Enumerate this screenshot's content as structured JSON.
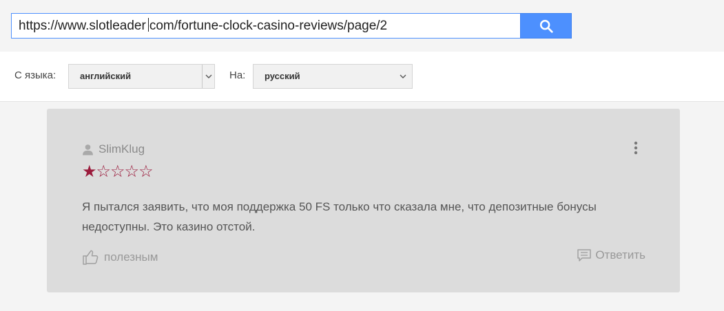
{
  "url_bar": {
    "url_part1": "https://www.slotleader",
    "url_part2": "com/fortune-clock-casino-reviews/page/2",
    "search_icon": "search-icon",
    "accent_color": "#4d90fe"
  },
  "languages": {
    "from_label": "С языка:",
    "from_value": "английский",
    "to_label": "На:",
    "to_value": "русский"
  },
  "review": {
    "username": "SlimKlug",
    "rating": 1,
    "max_rating": 5,
    "text": "Я пытался заявить, что моя поддержка 50 FS только что сказала мне, что депозитные бонусы недоступны. Это казино отстой.",
    "helpful_label": "полезным",
    "reply_label": "Ответить",
    "star_color": "#9b1b3c"
  }
}
